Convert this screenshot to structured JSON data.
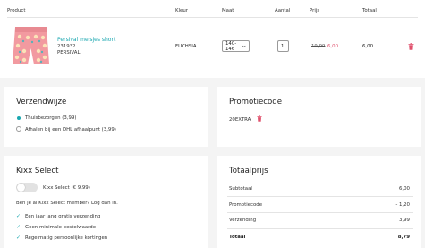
{
  "cart": {
    "headers": {
      "product": "Product",
      "color": "Kleur",
      "size": "Maat",
      "quantity": "Aantal",
      "price": "Prijs",
      "total": "Totaal"
    },
    "item": {
      "name": "Persival meisjes short",
      "number": "231932",
      "brand": "PERSIVAL",
      "color": "FUCHSIA",
      "size": "140-146",
      "quantity": "1",
      "old_price": "19,99",
      "new_price": "6,00",
      "total": "6,00"
    }
  },
  "shipping": {
    "title": "Verzendwijze",
    "options": [
      {
        "label": "Thuisbezorgen (3,99)",
        "selected": true
      },
      {
        "label": "Afhalen bij een DHL afhaalpunt (3,99)",
        "selected": false
      }
    ]
  },
  "promo": {
    "title": "Promotiecode",
    "code": "20EXTRA"
  },
  "kixx": {
    "title": "Kixx Select",
    "toggle_label": "Kixx Select (€ 9,99)",
    "question": "Ben je al Kixx Select member? Log dan in.",
    "benefits": [
      "Een jaar lang gratis verzending",
      "Geen minimale bestelwaarde",
      "Regelmatig persoonlijke kortingen"
    ]
  },
  "totals": {
    "title": "Totaalprijs",
    "rows": [
      {
        "label": "Subtotaal",
        "value": "6,00"
      },
      {
        "label": "Promotiecode",
        "value": "- 1,20"
      },
      {
        "label": "Verzending",
        "value": "3,99"
      },
      {
        "label": "Totaal",
        "value": "8,79"
      }
    ]
  },
  "colors": {
    "accent": "#1aa7b0",
    "sale": "#e0506c",
    "delete": "#e0506c"
  }
}
